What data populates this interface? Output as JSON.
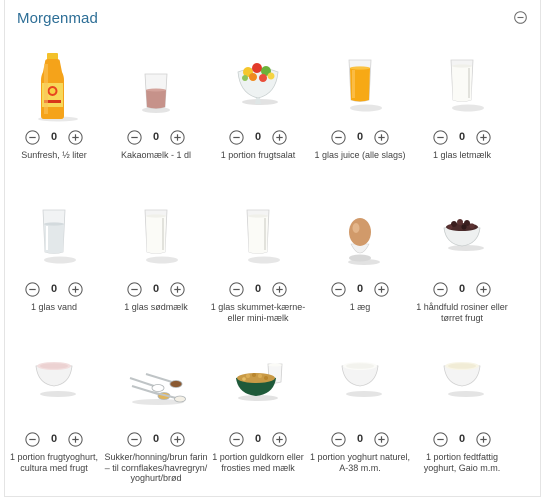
{
  "section": {
    "title": "Morgenmad",
    "collapse_icon": "minus-circle-icon"
  },
  "colors": {
    "title": "#2d6e96",
    "button_stroke": "#555555",
    "text": "#444444"
  },
  "items": [
    {
      "label": "Sunfresh, ½ liter",
      "qty": "0",
      "icon": "juice-bottle-icon"
    },
    {
      "label": "Kakaomælk - 1 dl",
      "qty": "0",
      "icon": "chocolate-milk-glass-icon"
    },
    {
      "label": "1 portion frugtsalat",
      "qty": "0",
      "icon": "fruit-salad-bowl-icon"
    },
    {
      "label": "1 glas juice (alle slags)",
      "qty": "0",
      "icon": "orange-juice-glass-icon"
    },
    {
      "label": "1 glas letmælk",
      "qty": "0",
      "icon": "milk-glass-icon"
    },
    {
      "label": "1 glas vand",
      "qty": "0",
      "icon": "water-glass-icon"
    },
    {
      "label": "1 glas sødmælk",
      "qty": "0",
      "icon": "milk-glass-icon"
    },
    {
      "label": "1 glas skummet-kærne- eller mini-mælk",
      "qty": "0",
      "icon": "milk-glass-icon"
    },
    {
      "label": "1 æg",
      "qty": "0",
      "icon": "egg-cup-icon"
    },
    {
      "label": "1 håndfuld rosiner eller tørret frugt",
      "qty": "0",
      "icon": "raisins-bowl-icon"
    },
    {
      "label": "1 portion frugtyoghurt, cultura med frugt",
      "qty": "0",
      "icon": "fruit-yoghurt-bowl-icon"
    },
    {
      "label": "Sukker/honning/brun farin – til cornflakes/havregryn/ yoghurt/brød",
      "qty": "0",
      "icon": "sugar-spoons-icon"
    },
    {
      "label": "1 portion guldkorn eller frosties med mælk",
      "qty": "0",
      "icon": "cereal-bowl-icon"
    },
    {
      "label": "1 portion yoghurt naturel, A-38 m.m.",
      "qty": "0",
      "icon": "yoghurt-bowl-icon"
    },
    {
      "label": "1 portion fedtfattig yoghurt, Gaio m.m.",
      "qty": "0",
      "icon": "yoghurt-bowl-icon"
    }
  ]
}
